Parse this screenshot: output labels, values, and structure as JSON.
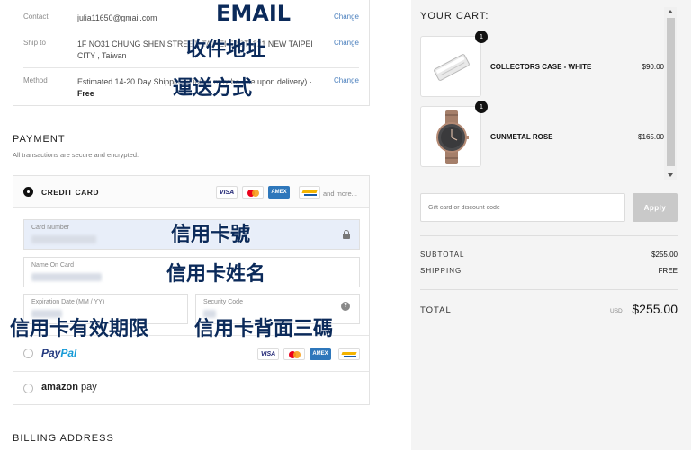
{
  "summary": {
    "contact": {
      "label": "Contact",
      "value": "julia11650@gmail.com",
      "change": "Change"
    },
    "ship_to": {
      "label": "Ship to",
      "value": "1F NO31 CHUNG SHEN STREET, TAIPEI EAST, 221 NEW TAIPEI CITY , Taiwan",
      "change": "Change"
    },
    "method": {
      "label": "Method",
      "value": "Estimated 14-20 Day Shipping (Duties may be due upon delivery) · ",
      "price": "Free",
      "change": "Change"
    }
  },
  "overlays": {
    "email": "EMAIL",
    "address": "收件地址",
    "shipping_method": "運送方式",
    "card_number": "信用卡號",
    "card_name": "信用卡姓名",
    "card_expiry": "信用卡有效期限",
    "card_cvv": "信用卡背面三碼"
  },
  "payment": {
    "title": "PAYMENT",
    "subtitle": "All transactions are secure and encrypted.",
    "credit_card_label": "CREDIT CARD",
    "and_more": "and more...",
    "card_number_label": "Card Number",
    "name_label": "Name On Card",
    "expiry_label": "Expiration Date (MM / YY)",
    "security_label": "Security Code",
    "paypal_1": "Pay",
    "paypal_2": "Pal",
    "amazon_1": "amazon",
    "amazon_2": " pay"
  },
  "billing": {
    "title": "BILLING ADDRESS"
  },
  "cart": {
    "title": "YOUR CART:",
    "items": [
      {
        "qty": "1",
        "name": "COLLECTORS CASE - WHITE",
        "price": "$90.00"
      },
      {
        "qty": "1",
        "name": "GUNMETAL ROSE",
        "price": "$165.00"
      }
    ],
    "gift_placeholder": "Gift card or discount code",
    "apply": "Apply",
    "subtotal_label": "SUBTOTAL",
    "subtotal": "$255.00",
    "shipping_label": "SHIPPING",
    "shipping": "FREE",
    "total_label": "TOTAL",
    "currency": "USD",
    "total": "$255.00"
  },
  "colors": {
    "accent_link": "#4a7fbd",
    "overlay_text": "#0b2a5a",
    "sidebar_bg": "#f4f4f4"
  }
}
